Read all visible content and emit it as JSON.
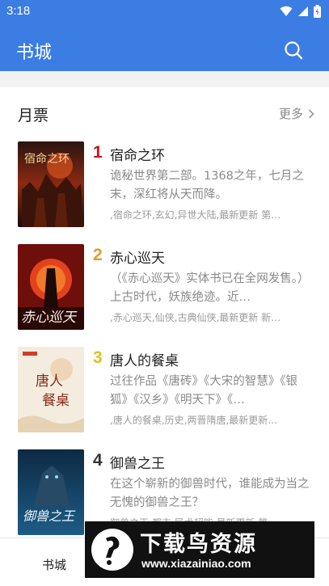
{
  "status_bar": {
    "time": "3:18"
  },
  "app_bar": {
    "title": "书城"
  },
  "section": {
    "title": "月票",
    "more_label": "更多"
  },
  "books": [
    {
      "rank": "1",
      "rank_color": "#c4161c",
      "title": "宿命之环",
      "desc": "诡秘世界第二部。1368之年，七月之末，深红将从天而降。",
      "tags": ",宿命之环,玄幻,异世大陆,最新更新 第…"
    },
    {
      "rank": "2",
      "rank_color": "#d9a12a",
      "title": "赤心巡天",
      "desc": "（《赤心巡天》实体书已在全网发售。）上古时代，妖族绝迹。近…",
      "tags": ",赤心巡天,仙侠,古典仙侠,最新更新 新…"
    },
    {
      "rank": "3",
      "rank_color": "#e0c020",
      "title": "唐人的餐桌",
      "desc": "过往作品《唐砖》《大宋的智慧》《银狐》《汉乡》《明天下》《…",
      "tags": ",唐人的餐桌,历史,两晋隋唐,最新更新…"
    },
    {
      "rank": "4",
      "rank_color": "#333333",
      "title": "御兽之王",
      "desc": "在这个崭新的御兽时代，谁能成为当之无愧的御兽之王？",
      "tags": "御兽之王,都市,异术超能,最新更新 第…"
    }
  ],
  "bottom_nav": {
    "items": [
      "书城"
    ]
  },
  "watermark": {
    "title": "下载鸟资源",
    "url": "www.xiazainiao.com"
  },
  "colors": {
    "accent": "#3b7de3"
  }
}
